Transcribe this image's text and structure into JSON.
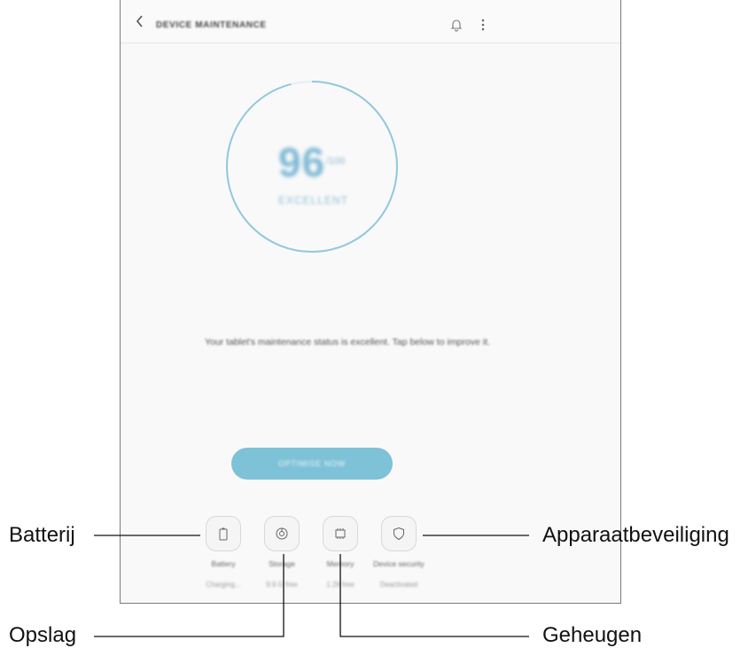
{
  "appbar": {
    "title": "DEVICE MAINTENANCE",
    "back_icon": "chevron-left-icon",
    "notification_icon": "bell-icon",
    "more_icon": "more-vertical-icon"
  },
  "score": {
    "value": "96",
    "max": "/100",
    "status": "EXCELLENT",
    "progress_fraction": 0.96
  },
  "message": "Your tablet's maintenance status is excellent. Tap below to improve it.",
  "optimize_button": "OPTIMISE NOW",
  "tiles": [
    {
      "label": "Battery",
      "sub": "Charging...",
      "icon": "battery-icon"
    },
    {
      "label": "Storage",
      "sub": "9.9 G free",
      "icon": "storage-icon"
    },
    {
      "label": "Memory",
      "sub": "1.28 free",
      "icon": "memory-chip-icon"
    },
    {
      "label": "Device security",
      "sub": "Deactivated",
      "icon": "shield-icon"
    }
  ],
  "callouts": {
    "batterij": "Batterij",
    "opslag": "Opslag",
    "geheugen": "Geheugen",
    "apparaatbeveiliging": "Apparaatbeveiliging"
  },
  "colors": {
    "ring": "#93c8dc",
    "accent_button": "#7ec2d7",
    "callout_line": "#111111"
  }
}
